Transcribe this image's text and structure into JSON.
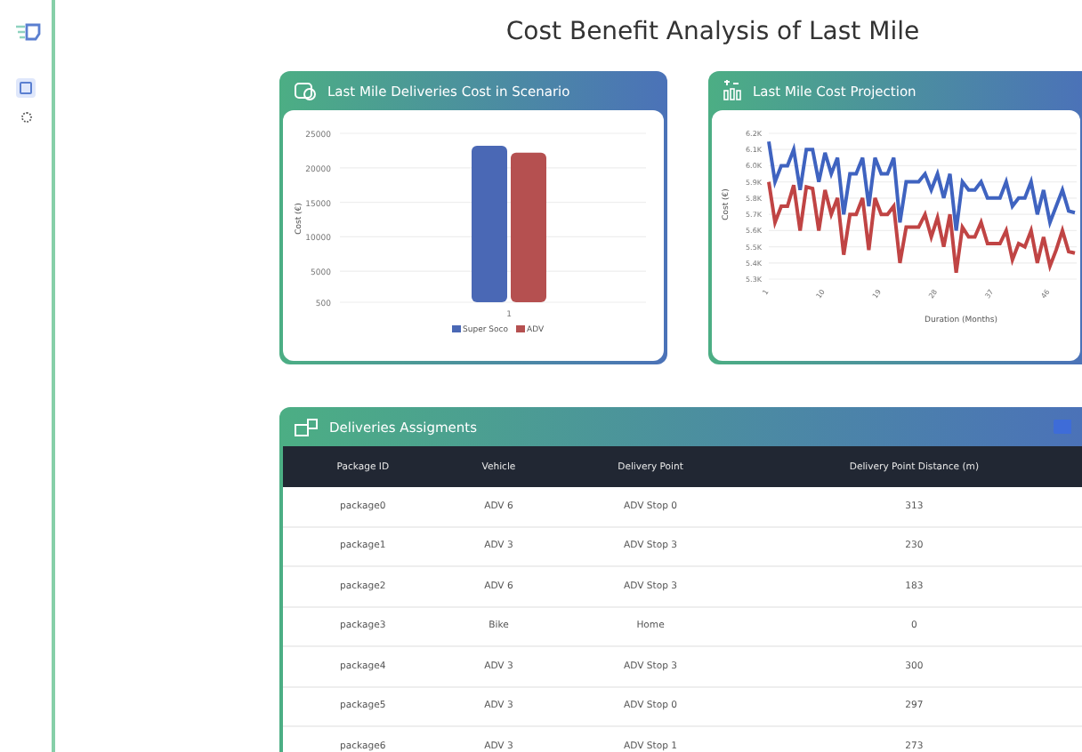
{
  "page_title": "Cost Benefit Analysis of Last Mile",
  "sidebar": {
    "items": [
      {
        "kind": "dashboard",
        "selected": true
      },
      {
        "kind": "settings",
        "selected": false
      }
    ]
  },
  "cost_card": {
    "title": "Last Mile Deliveries Cost in Scenario",
    "chart_data": {
      "type": "bar",
      "ylabel": "Cost (€)",
      "categories": [
        "1"
      ],
      "series": [
        {
          "name": "Super Soco",
          "color": "#4a68b5",
          "values": [
            23200
          ]
        },
        {
          "name": "ADV",
          "color": "#b55050",
          "values": [
            22200
          ]
        }
      ],
      "ylim": [
        500,
        25000
      ],
      "yticks": [
        500,
        5000,
        10000,
        15000,
        20000,
        25000
      ],
      "grid": true,
      "legend": true
    }
  },
  "projection_card": {
    "title": "Last Mile Cost Projection",
    "chart_data": {
      "type": "line",
      "xlabel": "Duration (Months)",
      "ylabel": "Cost (€)",
      "x": [
        1,
        2,
        3,
        4,
        5,
        6,
        7,
        8,
        9,
        10,
        11,
        12,
        13,
        14,
        15,
        16,
        17,
        18,
        19,
        20,
        21,
        22,
        23,
        24,
        25,
        26,
        27,
        28,
        29,
        30,
        31,
        32,
        33,
        34,
        35,
        36,
        37,
        38,
        39,
        40,
        41,
        42,
        43,
        44,
        45,
        46,
        47,
        48,
        49,
        50
      ],
      "series": [
        {
          "color": "#3f63c0",
          "values": [
            6150,
            5900,
            6000,
            6000,
            6100,
            5850,
            6100,
            6100,
            5900,
            6080,
            5950,
            6050,
            5700,
            5950,
            5950,
            6050,
            5750,
            6050,
            5950,
            5950,
            6050,
            5650,
            5900,
            5900,
            5900,
            5950,
            5850,
            5950,
            5800,
            5950,
            5600,
            5900,
            5850,
            5850,
            5900,
            5800,
            5800,
            5800,
            5900,
            5750,
            5800,
            5800,
            5900,
            5700,
            5850,
            5650,
            5750,
            5850,
            5720,
            5710
          ]
        },
        {
          "color": "#c04444",
          "values": [
            5900,
            5650,
            5750,
            5750,
            5880,
            5600,
            5870,
            5860,
            5600,
            5850,
            5700,
            5800,
            5450,
            5700,
            5700,
            5800,
            5480,
            5800,
            5700,
            5700,
            5750,
            5400,
            5620,
            5620,
            5620,
            5700,
            5560,
            5680,
            5500,
            5700,
            5340,
            5620,
            5560,
            5560,
            5650,
            5520,
            5520,
            5520,
            5600,
            5420,
            5520,
            5500,
            5600,
            5400,
            5560,
            5380,
            5480,
            5600,
            5470,
            5460
          ]
        }
      ],
      "ylim": [
        5300,
        6200
      ],
      "yticks": [
        {
          "value": 5300,
          "label": "5.3K"
        },
        {
          "value": 5400,
          "label": "5.4K"
        },
        {
          "value": 5500,
          "label": "5.5K"
        },
        {
          "value": 5600,
          "label": "5.6K"
        },
        {
          "value": 5700,
          "label": "5.7K"
        },
        {
          "value": 5800,
          "label": "5.8K"
        },
        {
          "value": 5900,
          "label": "5.9K"
        },
        {
          "value": 6000,
          "label": "6.0K"
        },
        {
          "value": 6100,
          "label": "6.1K"
        },
        {
          "value": 6200,
          "label": "6.2K"
        }
      ],
      "xlim": [
        1,
        50
      ],
      "xticks": [
        1,
        10,
        19,
        28,
        37,
        46
      ],
      "grid": true
    }
  },
  "table_card": {
    "title": "Deliveries Assigments",
    "columns": [
      "Package ID",
      "Vehicle",
      "Delivery Point",
      "Delivery Point Distance (m)"
    ],
    "rows": [
      [
        "package0",
        "ADV 6",
        "ADV Stop 0",
        "313"
      ],
      [
        "package1",
        "ADV 3",
        "ADV Stop 3",
        "230"
      ],
      [
        "package2",
        "ADV 6",
        "ADV Stop 3",
        "183"
      ],
      [
        "package3",
        "Bike",
        "Home",
        "0"
      ],
      [
        "package4",
        "ADV 3",
        "ADV Stop 3",
        "300"
      ],
      [
        "package5",
        "ADV 3",
        "ADV Stop 0",
        "297"
      ],
      [
        "package6",
        "ADV 3",
        "ADV Stop 1",
        "273"
      ]
    ]
  }
}
